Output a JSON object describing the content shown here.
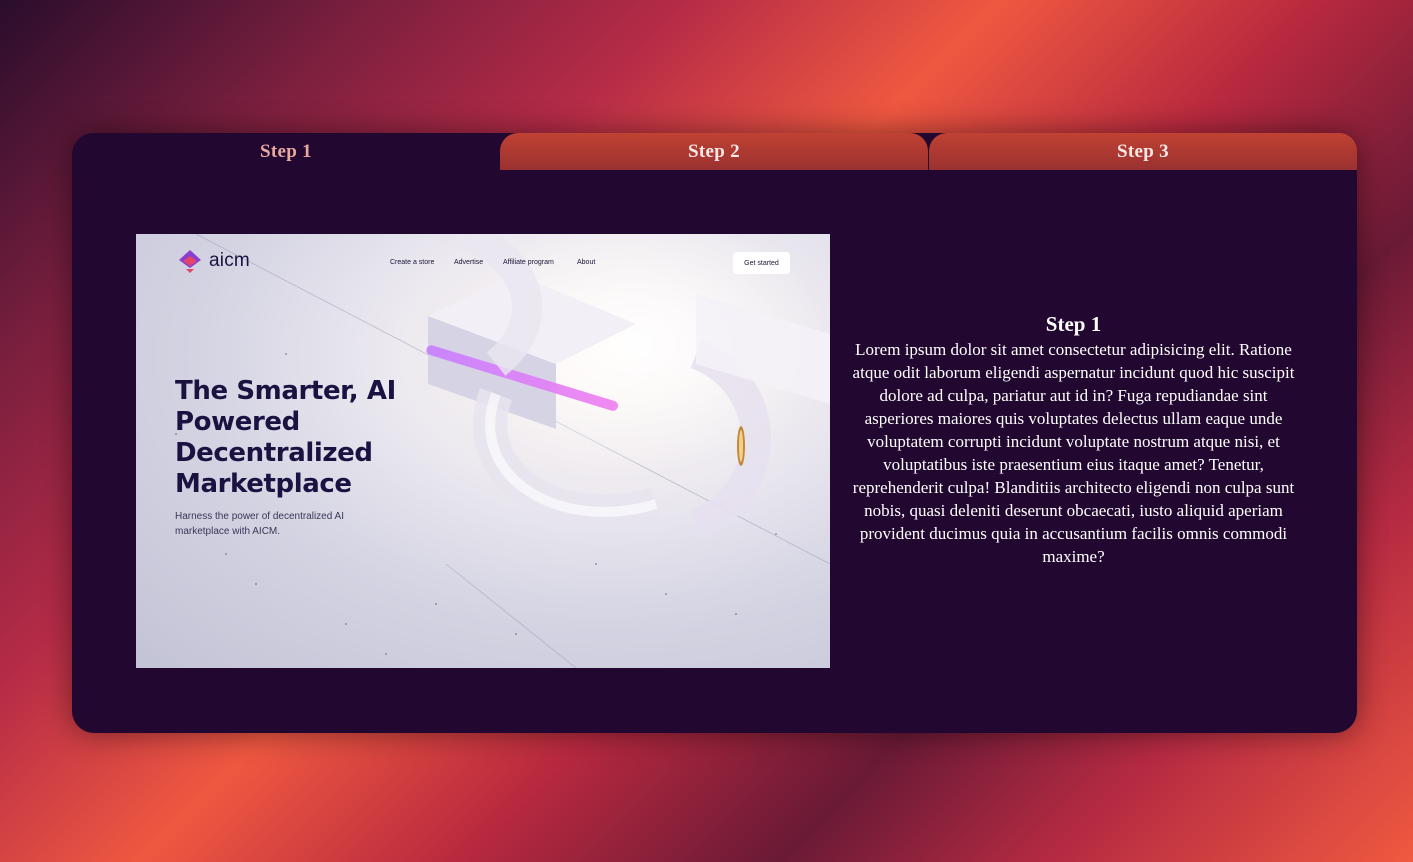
{
  "tabs": [
    {
      "label": "Step 1",
      "active": true
    },
    {
      "label": "Step 2",
      "active": false
    },
    {
      "label": "Step 3",
      "active": false
    }
  ],
  "preview": {
    "logo_text": "aicm",
    "nav": [
      "Create a store",
      "Advertise",
      "Affiliate program",
      "About"
    ],
    "cta": "Get started",
    "hero_title": "The Smarter, AI Powered Decentralized Marketplace",
    "hero_subtitle": "Harness the power of decentralized AI marketplace with AICM."
  },
  "content": {
    "heading": "Step 1",
    "body": "Lorem ipsum dolor sit amet consectetur adipisicing elit. Ratione atque odit laborum eligendi aspernatur incidunt quod hic suscipit dolore ad culpa, pariatur aut id in? Fuga repudiandae sint asperiores maiores quis voluptates delectus ullam eaque unde voluptatem corrupti incidunt voluptate nostrum atque nisi, et voluptatibus iste praesentium eius itaque amet? Tenetur, reprehenderit culpa! Blanditiis architecto eligendi non culpa sunt nobis, quasi deleniti deserunt obcaecati, iusto aliquid aperiam provident ducimus quia in accusantium facilis omnis commodi maxime?"
  },
  "colors": {
    "card": "#220830",
    "tab_inactive": "#b03a32",
    "tab_active_text": "#e9a8a0",
    "accent": "#ef5840",
    "preview_glow": "#b96cf5"
  }
}
